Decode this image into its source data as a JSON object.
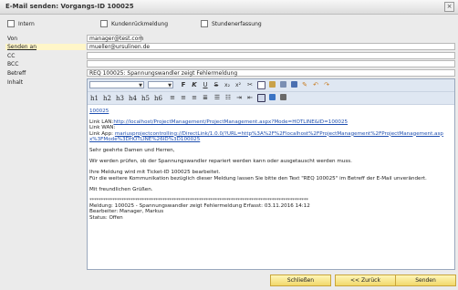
{
  "window": {
    "title": "E-Mail senden: Vorgangs-ID 100025"
  },
  "checkboxes": [
    {
      "label": "Intern"
    },
    {
      "label": "Kundenrückmeldung"
    },
    {
      "label": "Stundenerfassung"
    }
  ],
  "fields": {
    "von": {
      "label": "Von",
      "value": "manager@test.com"
    },
    "senden_an": {
      "label": "Senden an",
      "value": "mueller@ursulinen.de"
    },
    "cc": {
      "label": "CC",
      "value": ""
    },
    "bcc": {
      "label": "BCC",
      "value": ""
    },
    "betreff": {
      "label": "Betreff",
      "value": "REQ 100025: Spannungswandler zeigt Fehlermeldung"
    },
    "inhalt": {
      "label": "Inhalt"
    }
  },
  "toolbar": {
    "format_buttons": [
      "F",
      "K",
      "U",
      "S",
      "x₂",
      "x²"
    ],
    "headings": [
      "h1",
      "h2",
      "h3",
      "h4",
      "h5",
      "h6"
    ]
  },
  "body": {
    "ticket_link": "100025",
    "link_lan_label": "Link LAN:",
    "link_lan_url": "http://localhost/ProjectManagement/ProjectManagement.aspx?Mode=HOTLINE&ID=100025",
    "link_wan_label": "Link WAN:",
    "link_app_label": "Link App:",
    "link_app_url": "mariusprojectcontrolling://DirectLink/1.0.0/?URL=http%3A%2F%2Flocalhost%2FProjectManagement%2FProjectManagement.aspx%3FMode%3DHOTLINE%26ID%3D100025",
    "greeting": "Sehr geehrte Damen und Herren,",
    "line1": "Wir werden prüfen, ob der Spannungswandler repariert werden kann oder ausgetauscht werden muss.",
    "line2": "Ihre Meldung wird mit Ticket-ID 100025 bearbeitet.",
    "line3": "Für die weitere Kommunikation bezüglich dieser Meldung lassen Sie bitte den Text \"REQ 100025\" im Betreff der E-Mail unverändert.",
    "closing": "Mit freundlichen Grüßen.",
    "separator": "************************************************************************************************",
    "meta1": "Meldung: 100025 - Spannungswandler zeigt Fehlermeldung Erfasst: 03.11.2016 14:12",
    "meta2": "Bearbeiter: Manager, Markus",
    "meta3": "Status: Offen"
  },
  "buttons": {
    "schliessen": "Schließen",
    "zurueck": "<< Zurück",
    "senden": "Senden"
  },
  "colors": {
    "button_bg": "#f1d86a",
    "link": "#1f4fb0",
    "selected_label": "#fff6c8"
  }
}
